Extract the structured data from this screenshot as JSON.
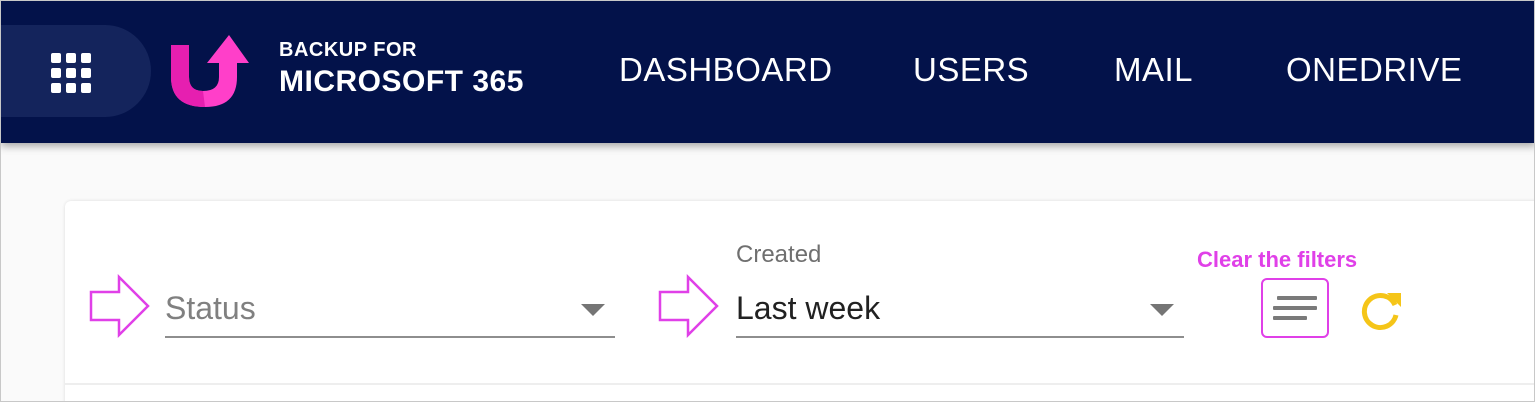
{
  "header": {
    "brand_line1": "BACKUP FOR",
    "brand_line2": "MICROSOFT 365",
    "nav": [
      {
        "label": "DASHBOARD"
      },
      {
        "label": "USERS"
      },
      {
        "label": "MAIL"
      },
      {
        "label": "ONEDRIVE"
      }
    ]
  },
  "filters": {
    "status": {
      "placeholder": "Status"
    },
    "created": {
      "label": "Created",
      "value": "Last week"
    },
    "clear_hint": "Clear the filters"
  },
  "icons": {
    "apps": "apps-grid-icon",
    "logo": "backup-arrow-logo",
    "pointer": "outline-right-arrow",
    "clear": "clear-filters-lines-icon",
    "refresh": "refresh-icon"
  },
  "colors": {
    "header_bg": "#03124a",
    "apps_btn_bg": "#14245c",
    "logo_pink": "#ff3fc9",
    "annotation_magenta": "#e040e8",
    "refresh_yellow": "#f5c518"
  }
}
